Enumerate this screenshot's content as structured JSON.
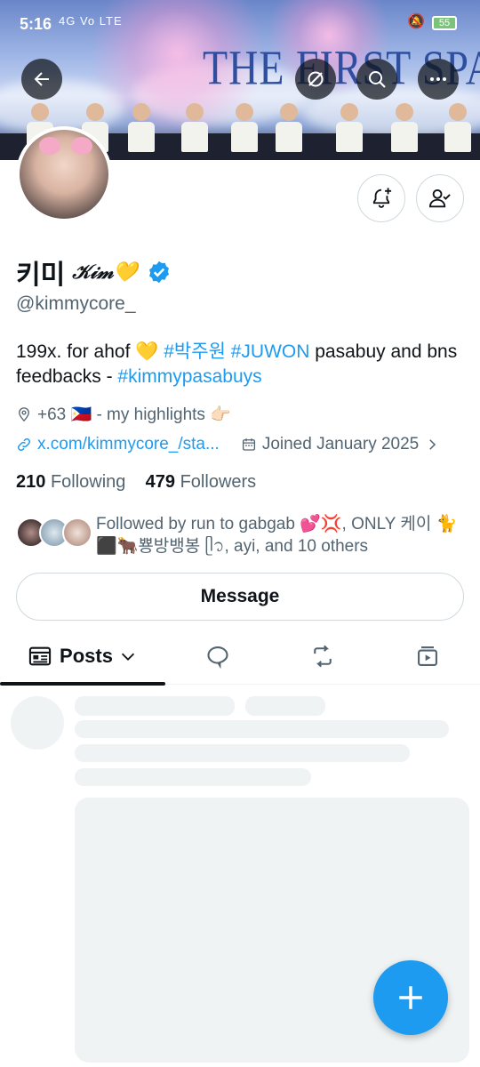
{
  "status_bar": {
    "time": "5:16",
    "network": "4G Vo LTE",
    "battery": "55"
  },
  "banner": {
    "title": "THE FIRST SPARK"
  },
  "header_icons": {
    "back": "arrow-left-icon",
    "grok": "grok-icon",
    "search": "search-icon",
    "more": "more-icon"
  },
  "profile": {
    "name": "키미",
    "name_script": "𝒦𝒾𝓂💛",
    "handle": "@kimmycore_",
    "bio_parts": {
      "p1": "199x. for ahof 💛 ",
      "tag1": "#박주원",
      "sp1": " ",
      "tag2": "#JUWON",
      "p2": " pasabuy and bns feedbacks - ",
      "tag3": "#kimmypasabuys"
    },
    "location": "+63 🇵🇭 - my highlights  👉🏻",
    "link": "x.com/kimmycore_/sta...",
    "joined": "Joined January 2025",
    "following_count": "210",
    "following_label": "Following",
    "followers_count": "479",
    "followers_label": "Followers",
    "followed_by": "Followed by run to gabgab 💕💢, ONLY 케이 🐈⬛🐂뿅방뱅봉 ᥫ᭡, ayi, and 10 others"
  },
  "actions": {
    "message_label": "Message"
  },
  "tabs": {
    "posts_label": "Posts"
  },
  "colors": {
    "accent": "#1d9bf0",
    "text": "#0f1419",
    "muted": "#536471",
    "skeleton": "#eff3f4"
  }
}
